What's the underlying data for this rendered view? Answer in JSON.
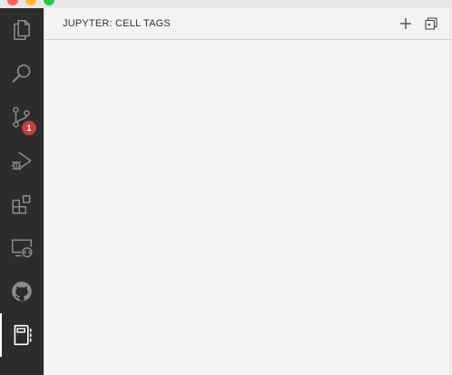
{
  "window": {
    "traffic_lights": [
      {
        "name": "close",
        "color": "#ff5f57"
      },
      {
        "name": "minimize",
        "color": "#febc2e"
      },
      {
        "name": "zoom",
        "color": "#28c840"
      }
    ]
  },
  "activity_bar": {
    "items": [
      {
        "name": "explorer",
        "icon": "files-icon"
      },
      {
        "name": "search",
        "icon": "search-icon"
      },
      {
        "name": "source-control",
        "icon": "source-control-icon",
        "badge": "1"
      },
      {
        "name": "run-and-debug",
        "icon": "run-debug-icon"
      },
      {
        "name": "extensions",
        "icon": "extensions-icon"
      },
      {
        "name": "remote-explorer",
        "icon": "remote-explorer-icon"
      },
      {
        "name": "github",
        "icon": "github-icon"
      },
      {
        "name": "jupyter",
        "icon": "notebook-icon",
        "active": true
      }
    ]
  },
  "sidebar": {
    "title": "JUPYTER: CELL TAGS",
    "actions": [
      {
        "name": "add-tag",
        "icon": "plus-icon"
      },
      {
        "name": "collapse",
        "icon": "collapse-all-icon"
      }
    ]
  },
  "colors": {
    "activity_bar_bg": "#2c2c2c",
    "icon_color": "#8c8c8c",
    "active_icon_color": "#ffffff",
    "badge_bg": "#c2413a",
    "sidebar_bg": "#f3f3f3"
  }
}
